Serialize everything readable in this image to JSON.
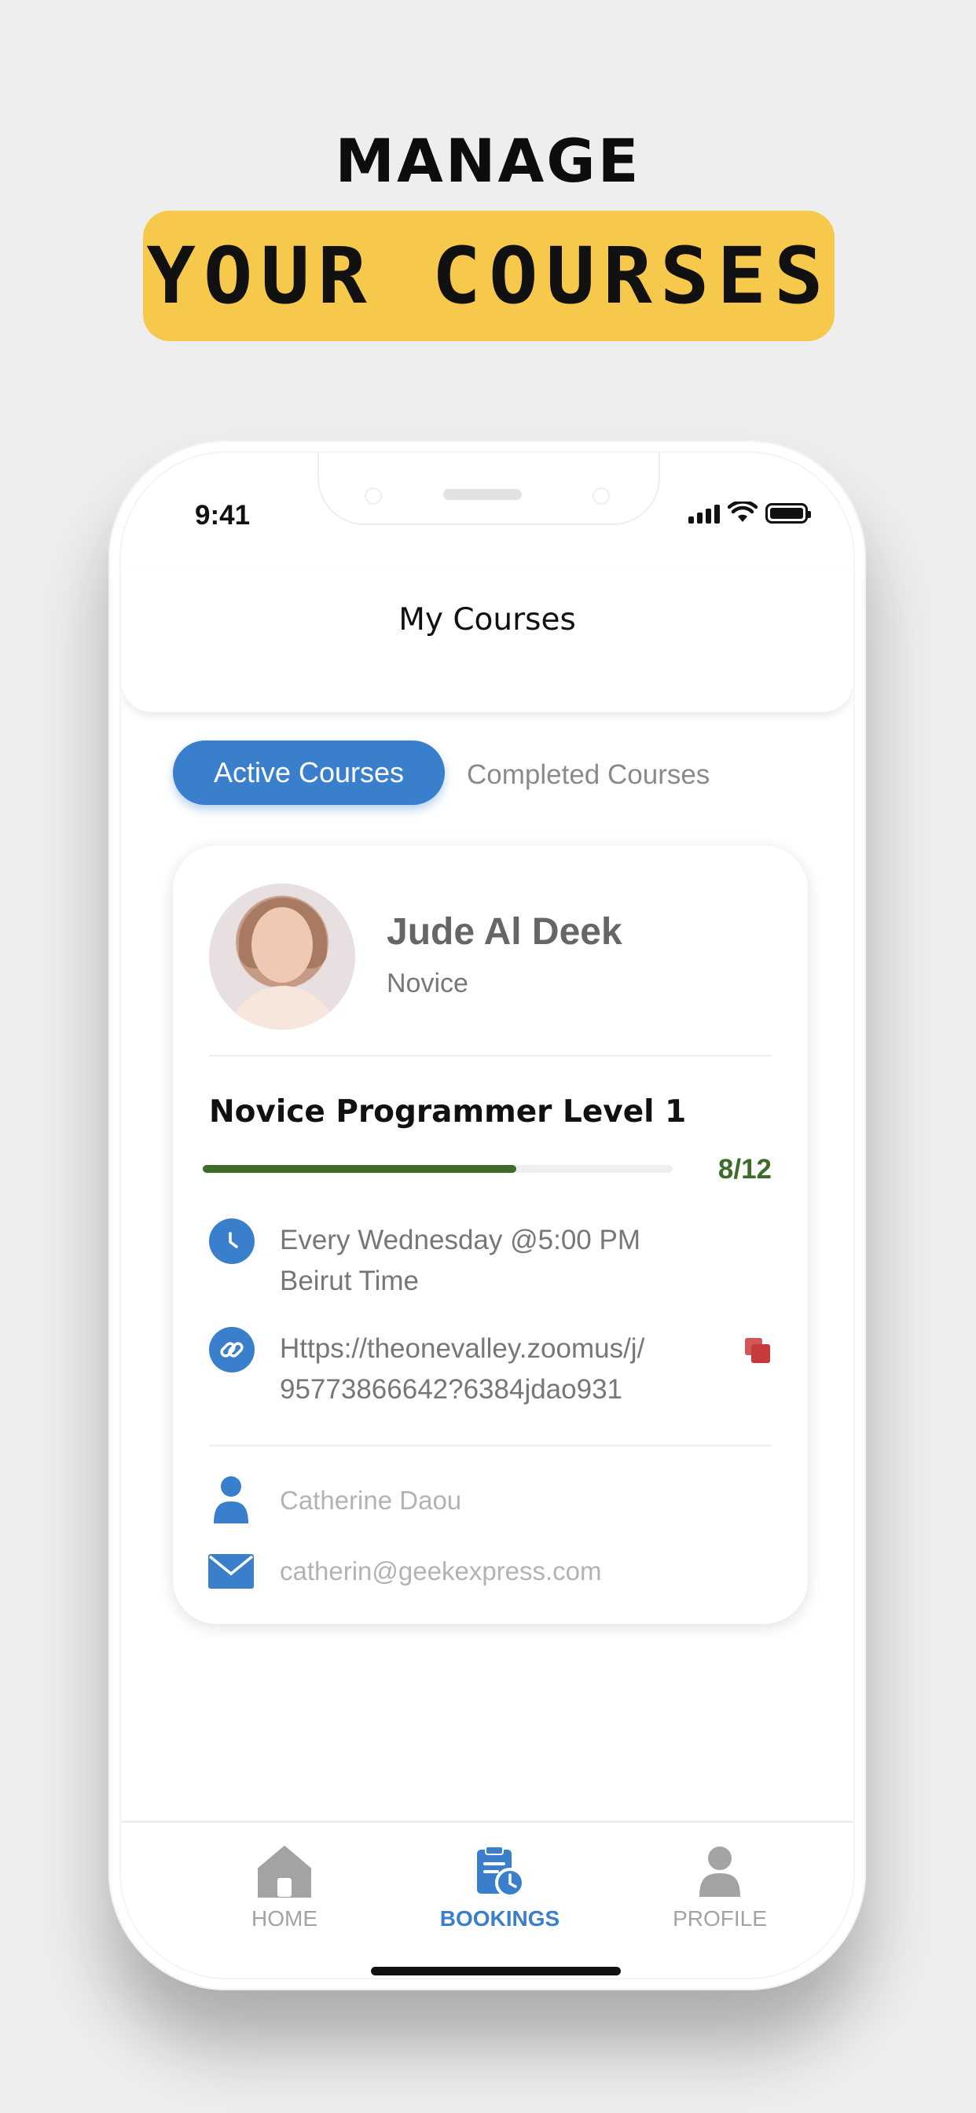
{
  "promo": {
    "headline": "MANAGE",
    "banner": "YOUR COURSES"
  },
  "status_bar": {
    "time": "9:41"
  },
  "header": {
    "title": "My Courses"
  },
  "tabs": {
    "active": "Active Courses",
    "completed": "Completed Courses"
  },
  "course_card": {
    "student_name": "Jude Al Deek",
    "student_level": "Novice",
    "course_title": "Novice Programmer Level 1",
    "progress": {
      "completed": 8,
      "total": 12,
      "label": "8/12"
    },
    "schedule_line1": "Every Wednesday @5:00 PM",
    "schedule_line2": "Beirut Time",
    "link_line1": "Https://theonevalley.zoomus/j/",
    "link_line2": "95773866642?6384jdao931",
    "teacher_name": "Catherine Daou",
    "teacher_email": "catherin@geekexpress.com"
  },
  "tab_bar": {
    "items": [
      {
        "label": "HOME",
        "icon": "home-icon",
        "active": false
      },
      {
        "label": "BOOKINGS",
        "icon": "bookings-icon",
        "active": true
      },
      {
        "label": "PROFILE",
        "icon": "profile-icon",
        "active": false
      }
    ]
  },
  "colors": {
    "accent": "#3a7fcc",
    "banner": "#f6c94c",
    "progress": "#3e6b2a",
    "copy": "#c83a3a",
    "inactive": "#a3a3a3"
  }
}
